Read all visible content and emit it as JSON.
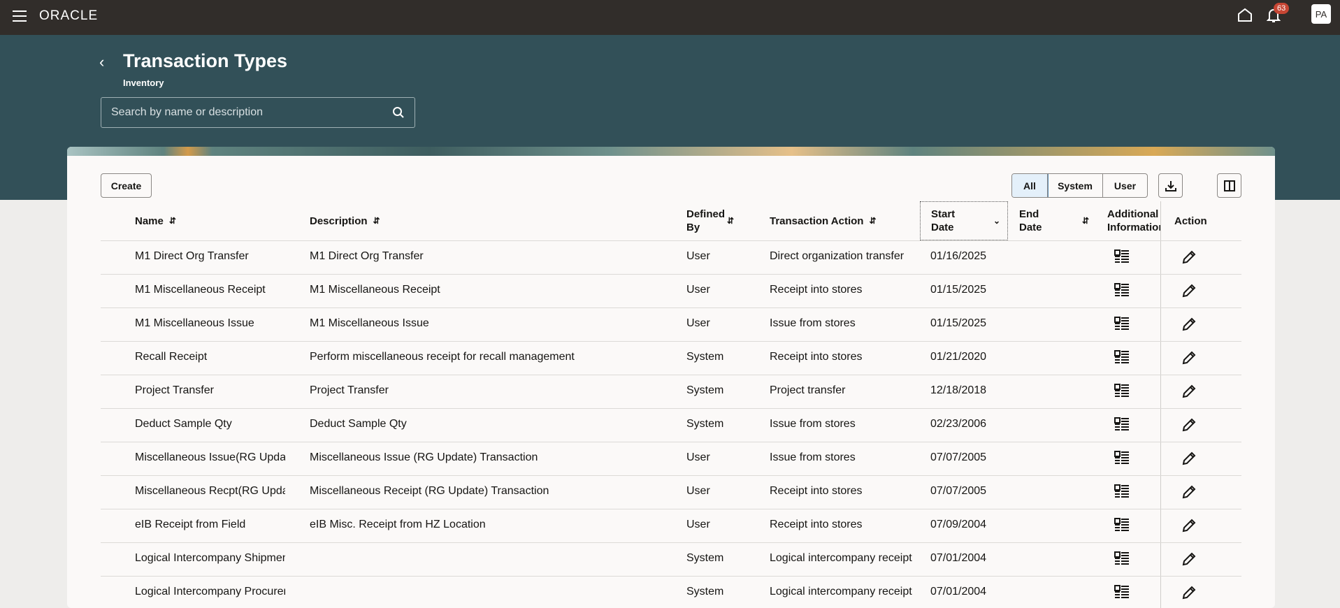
{
  "topbar": {
    "brand": "ORACLE",
    "notifications": "63",
    "avatar": "PA"
  },
  "page": {
    "title": "Transaction Types",
    "subtitle": "Inventory",
    "search_placeholder": "Search by name or description"
  },
  "toolbar": {
    "create": "Create",
    "filters": [
      "All",
      "System",
      "User"
    ],
    "selected_filter": "All"
  },
  "columns": {
    "name": "Name",
    "description": "Description",
    "defined_by": "Defined By",
    "transaction_action": "Transaction Action",
    "start_date": "Start Date",
    "end_date": "End Date",
    "additional_info": "Additional Information",
    "action": "Action"
  },
  "rows": [
    {
      "name": "M1 Direct Org Transfer",
      "description": "M1 Direct Org Transfer",
      "defined_by": "User",
      "transaction_action": "Direct organization transfer",
      "start_date": "01/16/2025",
      "end_date": ""
    },
    {
      "name": "M1 Miscellaneous Receipt",
      "description": "M1 Miscellaneous Receipt",
      "defined_by": "User",
      "transaction_action": "Receipt into stores",
      "start_date": "01/15/2025",
      "end_date": ""
    },
    {
      "name": "M1 Miscellaneous Issue",
      "description": "M1 Miscellaneous Issue",
      "defined_by": "User",
      "transaction_action": "Issue from stores",
      "start_date": "01/15/2025",
      "end_date": ""
    },
    {
      "name": "Recall Receipt",
      "description": "Perform miscellaneous receipt for recall management",
      "defined_by": "System",
      "transaction_action": "Receipt into stores",
      "start_date": "01/21/2020",
      "end_date": ""
    },
    {
      "name": "Project Transfer",
      "description": "Project Transfer",
      "defined_by": "System",
      "transaction_action": "Project transfer",
      "start_date": "12/18/2018",
      "end_date": ""
    },
    {
      "name": "Deduct Sample Qty",
      "description": "Deduct Sample Qty",
      "defined_by": "System",
      "transaction_action": "Issue from stores",
      "start_date": "02/23/2006",
      "end_date": ""
    },
    {
      "name": "Miscellaneous Issue(RG Update)",
      "description": "Miscellaneous Issue (RG Update) Transaction",
      "defined_by": "User",
      "transaction_action": "Issue from stores",
      "start_date": "07/07/2005",
      "end_date": ""
    },
    {
      "name": "Miscellaneous Recpt(RG Update)",
      "description": "Miscellaneous Receipt (RG Update) Transaction",
      "defined_by": "User",
      "transaction_action": "Receipt into stores",
      "start_date": "07/07/2005",
      "end_date": ""
    },
    {
      "name": "eIB Receipt from Field",
      "description": "eIB Misc. Receipt from HZ Location",
      "defined_by": "User",
      "transaction_action": "Receipt into stores",
      "start_date": "07/09/2004",
      "end_date": ""
    },
    {
      "name": "Logical Intercompany Shipment",
      "description": "",
      "defined_by": "System",
      "transaction_action": "Logical intercompany receipt",
      "start_date": "07/01/2004",
      "end_date": ""
    },
    {
      "name": "Logical Intercompany Procurement",
      "description": "",
      "defined_by": "System",
      "transaction_action": "Logical intercompany receipt",
      "start_date": "07/01/2004",
      "end_date": ""
    }
  ]
}
